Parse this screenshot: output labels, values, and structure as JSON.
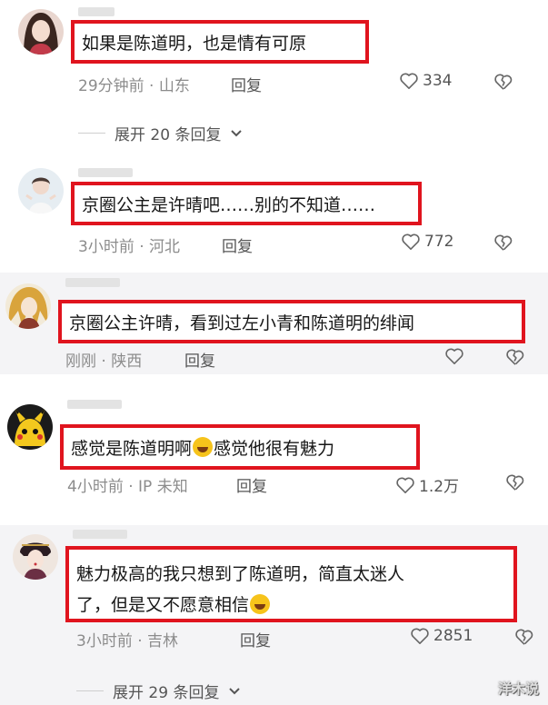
{
  "comments": [
    {
      "text": "如果是陈道明，也是情有可原",
      "meta": "29分钟前 · 山东",
      "reply_label": "回复",
      "likes": "334",
      "expand_label": "展开 20 条回复"
    },
    {
      "text": "京圈公主是许晴吧……别的不知道……",
      "meta": "3小时前 · 河北",
      "reply_label": "回复",
      "likes": "772"
    },
    {
      "text": "京圈公主许晴，看到过左小青和陈道明的绯闻",
      "meta": "刚刚 · 陕西",
      "reply_label": "回复",
      "likes": ""
    },
    {
      "text_before": "感觉是陈道明啊",
      "text_after": "感觉他很有魅力",
      "meta": "4小时前 · IP 未知",
      "reply_label": "回复",
      "likes": "1.2万"
    },
    {
      "text_line1": "魅力极高的我只想到了陈道明，简直太迷人",
      "text_line2": "了，但是又不愿意相信",
      "meta": "3小时前 · 吉林",
      "reply_label": "回复",
      "likes": "2851",
      "expand_label": "展开 29 条回复"
    }
  ],
  "icons": {
    "like": "heart-outline-icon",
    "dislike": "broken-heart-icon",
    "expand": "chevron-down-icon",
    "emoji": "laughing-crying-emoji-icon"
  },
  "watermark": "洋木说",
  "colors": {
    "highlight_border": "#e0141e",
    "meta_text": "#8c8c8c",
    "alt_background": "#f4f4f6"
  }
}
